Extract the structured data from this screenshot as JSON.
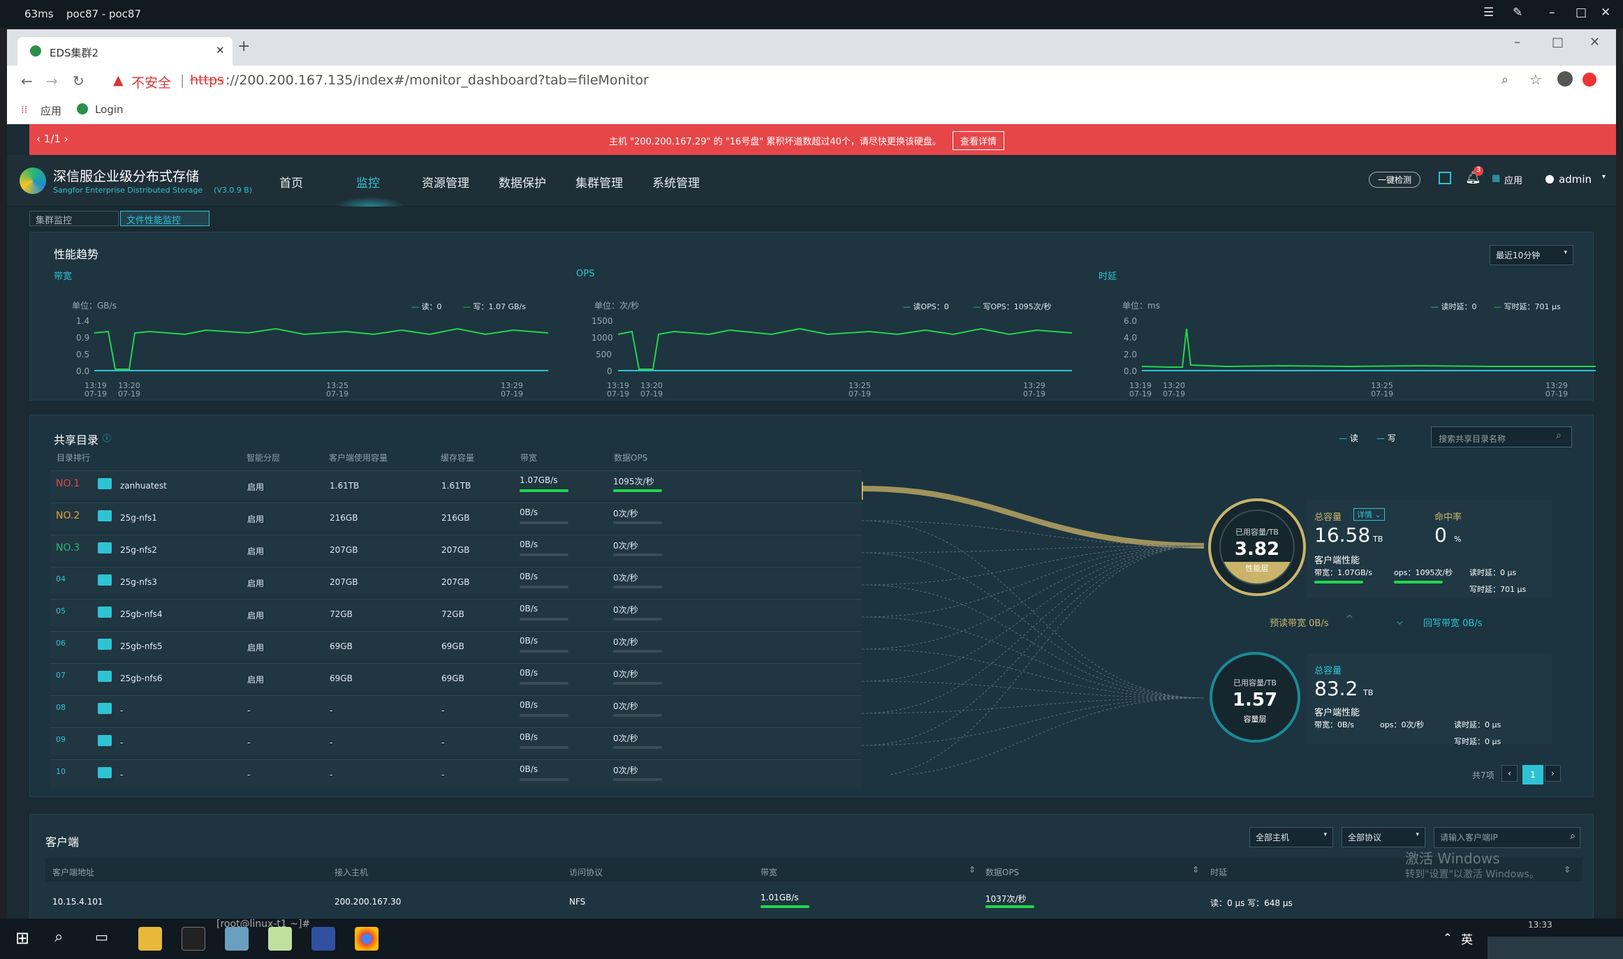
{
  "rdp": {
    "latency": "63ms",
    "title": "poc87 - poc87"
  },
  "browser": {
    "tab_title": "EDS集群2",
    "insecure": "不安全",
    "url_https": "https",
    "url_rest": "://200.200.167.135/index#/monitor_dashboard?tab=fileMonitor",
    "bookmarks": [
      "应用",
      "Login"
    ]
  },
  "alert": {
    "pager": "1/1",
    "message": "主机 \"200.200.167.29\" 的 \"16号盘\" 累积坏道数超过40个，请尽快更换该硬盘。",
    "button": "查看详情"
  },
  "brand": {
    "name": "深信服企业级分布式存储",
    "sub": "Sangfor Enterprise Distributed Storage",
    "version": "(V3.0.9 B)"
  },
  "nav": [
    "首页",
    "监控",
    "资源管理",
    "数据保护",
    "集群管理",
    "系统管理"
  ],
  "header_right": {
    "detect": "一键检测",
    "notif_count": "3",
    "apps": "应用",
    "user": "admin"
  },
  "subtabs": [
    "集群监控",
    "文件性能监控"
  ],
  "perf": {
    "title": "性能趋势",
    "range": "最近10分钟",
    "bandwidth": {
      "label": "带宽",
      "unit": "单位：GB/s",
      "legend_read": "读：0",
      "legend_write": "写：1.07 GB/s",
      "yticks": [
        "1.4",
        "0.9",
        "0.5",
        "0.0"
      ]
    },
    "ops": {
      "label": "OPS",
      "unit": "单位：次/秒",
      "legend_read": "读OPS：0",
      "legend_write": "写OPS：1095次/秒",
      "yticks": [
        "1500",
        "1000",
        "500",
        "0"
      ]
    },
    "latency": {
      "label": "时延",
      "unit": "单位：ms",
      "legend_read": "读时延：0",
      "legend_write": "写时延：701 μs",
      "yticks": [
        "6.0",
        "4.0",
        "2.0",
        "0.0"
      ]
    },
    "xticks": [
      [
        "13:19",
        "07-19"
      ],
      [
        "13:20",
        "07-19"
      ],
      [
        "13:25",
        "07-19"
      ],
      [
        "13:29",
        "07-19"
      ]
    ]
  },
  "shares": {
    "title": "共享目录",
    "legend": [
      "读",
      "写"
    ],
    "search_placeholder": "搜索共享目录名称",
    "headers": [
      "目录排行",
      "智能分层",
      "客户端使用容量",
      "缓存容量",
      "带宽",
      "数据OPS"
    ],
    "rows": [
      [
        "NO.1",
        "zanhuatest",
        "启用",
        "1.61TB",
        "1.61TB",
        "1.07GB/s",
        "1095次/秒"
      ],
      [
        "NO.2",
        "25g-nfs1",
        "启用",
        "216GB",
        "216GB",
        "0B/s",
        "0次/秒"
      ],
      [
        "NO.3",
        "25g-nfs2",
        "启用",
        "207GB",
        "207GB",
        "0B/s",
        "0次/秒"
      ],
      [
        "04",
        "25g-nfs3",
        "启用",
        "207GB",
        "207GB",
        "0B/s",
        "0次/秒"
      ],
      [
        "05",
        "25gb-nfs4",
        "启用",
        "72GB",
        "72GB",
        "0B/s",
        "0次/秒"
      ],
      [
        "06",
        "25gb-nfs5",
        "启用",
        "69GB",
        "69GB",
        "0B/s",
        "0次/秒"
      ],
      [
        "07",
        "25gb-nfs6",
        "启用",
        "69GB",
        "69GB",
        "0B/s",
        "0次/秒"
      ],
      [
        "08",
        "-",
        "-",
        "-",
        "-",
        "0B/s",
        "0次/秒"
      ],
      [
        "09",
        "-",
        "-",
        "-",
        "-",
        "0B/s",
        "0次/秒"
      ],
      [
        "10",
        "-",
        "-",
        "-",
        "-",
        "0B/s",
        "0次/秒"
      ]
    ],
    "pager_total": "共7项",
    "page": "1"
  },
  "perf_tier": {
    "used_label": "已用容量/TB",
    "used": "3.82",
    "tier": "性能层",
    "total_label": "总容量",
    "detail": "详情",
    "total": "16.58",
    "unit": "TB",
    "hit_label": "命中率",
    "hit": "0",
    "hit_unit": "%",
    "client_perf": "客户端性能",
    "bw": "带宽：1.07GB/s",
    "ops": "ops：1095次/秒",
    "read_lat": "读时延：0 μs",
    "write_lat": "写时延：701 μs"
  },
  "flow": {
    "preread": "预读带宽 0B/s",
    "writeback": "回写带宽 0B/s"
  },
  "cap_tier": {
    "used_label": "已用容量/TB",
    "used": "1.57",
    "tier": "容量层",
    "total_label": "总容量",
    "total": "83.2",
    "unit": "TB",
    "client_perf": "客户端性能",
    "bw": "带宽：0B/s",
    "ops": "ops：0次/秒",
    "read_lat": "读时延：0 μs",
    "write_lat": "写时延：0 μs"
  },
  "clients": {
    "title": "客户端",
    "host_filter": "全部主机",
    "proto_filter": "全部协议",
    "ip_placeholder": "请输入客户端IP",
    "headers": [
      "客户端地址",
      "接入主机",
      "访问协议",
      "带宽",
      "数据OPS",
      "时延"
    ],
    "row": [
      "10.15.4.101",
      "200.200.167.30",
      "NFS",
      "1.01GB/s",
      "1037次/秒",
      "读：0 μs 写：648 μs"
    ]
  },
  "watermark": {
    "line1": "激活 Windows",
    "line2": "转到\"设置\"以激活 Windows。"
  },
  "taskbar": {
    "lang": "英",
    "time": "13:33",
    "terminal": "[root@linux-t1 ~]# "
  },
  "colors": {
    "accent": "#2ec3d3",
    "green": "#22d64a",
    "gold": "#c9b46a",
    "alert": "#e74649"
  }
}
